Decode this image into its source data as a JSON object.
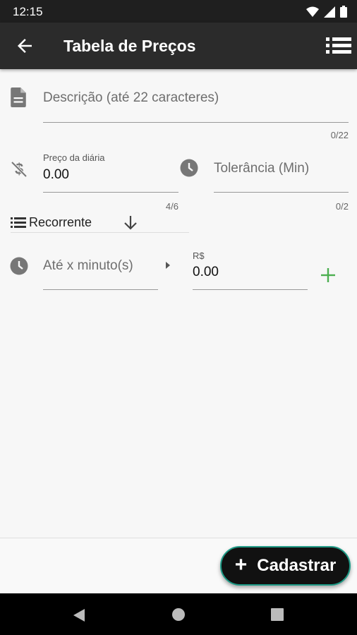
{
  "status_bar": {
    "time": "12:15"
  },
  "app_bar": {
    "title": "Tabela de Preços",
    "back_icon": "arrow-left-icon",
    "menu_icon": "list-icon"
  },
  "form": {
    "description": {
      "placeholder": "Descrição (até 22 caracteres)",
      "counter": "0/22",
      "icon": "document-icon"
    },
    "daily_price": {
      "label": "Preço da diária",
      "value": "0.00",
      "counter": "4/6",
      "icon": "money-off-icon"
    },
    "tolerance": {
      "placeholder": "Tolerância (Min)",
      "counter": "0/2",
      "icon": "clock-icon"
    },
    "recurrence": {
      "value": "Recorrente",
      "icon": "list-icon",
      "dropdown_icon": "arrow-down-icon"
    },
    "interval": {
      "placeholder": "Até x minuto(s)",
      "icon": "clock-icon",
      "arrow_icon": "caret-right-icon"
    },
    "price": {
      "label": "R$",
      "value": "0.00"
    },
    "add_icon": "plus-icon"
  },
  "fab": {
    "label": "Cadastrar",
    "icon": "plus-icon"
  },
  "colors": {
    "accent": "#4caf50",
    "fab_border": "#1e9a86",
    "app_bar": "#2b2b2b"
  }
}
